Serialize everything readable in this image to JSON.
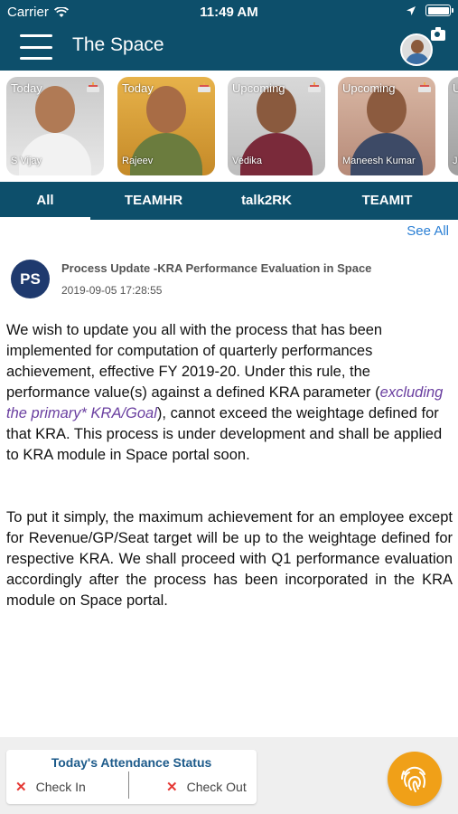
{
  "status_bar": {
    "carrier": "Carrier",
    "time": "11:49 AM"
  },
  "header": {
    "title": "The Space"
  },
  "people": [
    {
      "tag": "Today",
      "name": "S Vijay"
    },
    {
      "tag": "Today",
      "name": "Rajeev"
    },
    {
      "tag": "Upcoming",
      "name": "Vedika"
    },
    {
      "tag": "Upcoming",
      "name": "Maneesh Kumar"
    },
    {
      "tag": "U",
      "name": "J"
    }
  ],
  "tabs": [
    "All",
    "TEAMHR",
    "talk2RK",
    "TEAMIT"
  ],
  "see_all": "See All",
  "post": {
    "avatar_initials": "PS",
    "title": "Process Update -KRA Performance Evaluation in Space",
    "date": "2019-09-05 17:28:55",
    "para1_a": "We wish to update you all with the process that has been implemented for computation of quarterly performances achievement, effective FY 2019-20. Under this rule, the performance value(s) against a defined KRA parameter (",
    "para1_em": "excluding the primary* KRA/Goal",
    "para1_b": "), cannot exceed the weightage defined for that KRA. This process is under development and shall be applied to KRA module in Space portal soon.",
    "para2": "To put it simply, the maximum achievement for an employee except for Revenue/GP/Seat target will be up to the weightage defined for respective KRA. We shall proceed with Q1 performance evaluation accordingly after the process has been incorporated in the KRA module on Space portal."
  },
  "attendance": {
    "title": "Today's Attendance Status",
    "check_in": "Check In",
    "check_out": "Check Out",
    "mark": "✕"
  },
  "colors": {
    "header": "#0d4f6b",
    "accent": "#f0a018",
    "link": "#2a7fd4"
  }
}
